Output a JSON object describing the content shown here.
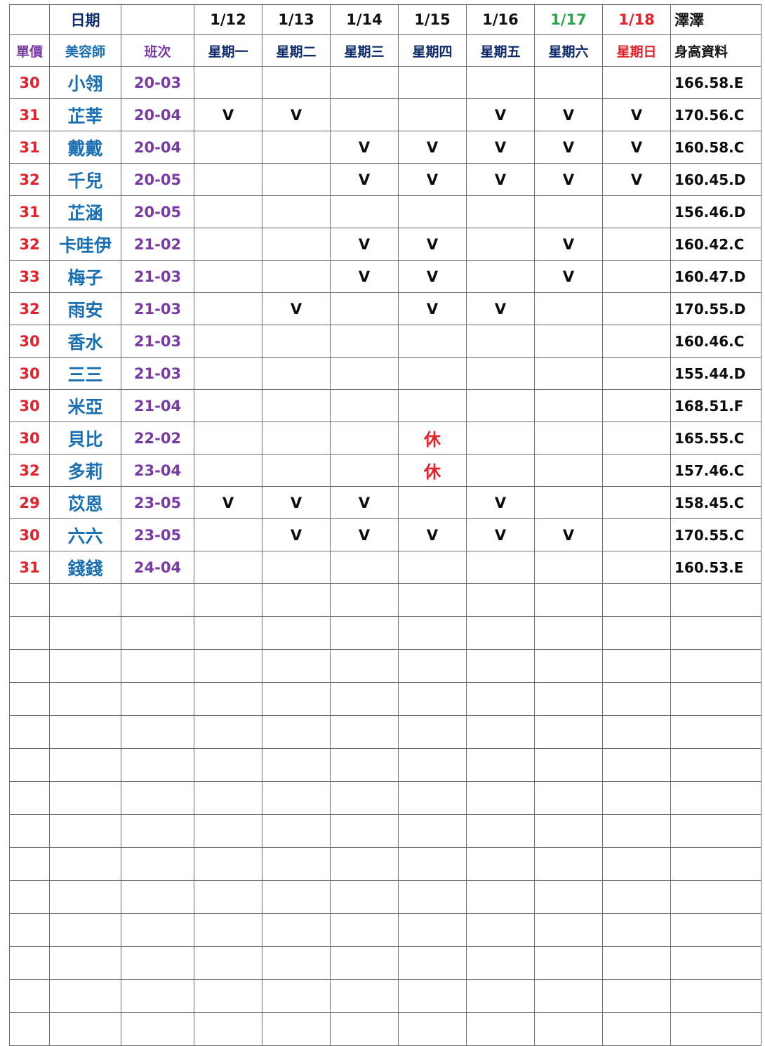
{
  "header": {
    "date_label": "日期",
    "price_label": "單價",
    "beautician_label": "美容師",
    "shift_label": "班次",
    "dates": [
      {
        "date": "1/12",
        "weekday": "星期一",
        "style": "normal"
      },
      {
        "date": "1/13",
        "weekday": "星期二",
        "style": "normal"
      },
      {
        "date": "1/14",
        "weekday": "星期三",
        "style": "normal"
      },
      {
        "date": "1/15",
        "weekday": "星期四",
        "style": "normal"
      },
      {
        "date": "1/16",
        "weekday": "星期五",
        "style": "normal"
      },
      {
        "date": "1/17",
        "weekday": "星期六",
        "style": "sat"
      },
      {
        "date": "1/18",
        "weekday": "星期日",
        "style": "sun"
      }
    ],
    "right_top": "澤澤",
    "right_bottom": "身高資料",
    "colors": {
      "price": "#e3212b",
      "name": "#1a6fb3",
      "shift": "#7a3aa4",
      "saturday": "#2aa64a",
      "sunday": "#e3212b"
    }
  },
  "rows": [
    {
      "price": "30",
      "name": "小翎",
      "shift": "20-03",
      "days": [
        "",
        "",
        "",
        "",
        "",
        "",
        ""
      ],
      "height": "166.58.E"
    },
    {
      "price": "31",
      "name": "芷莘",
      "shift": "20-04",
      "days": [
        "V",
        "V",
        "",
        "",
        "V",
        "V",
        "V"
      ],
      "height": "170.56.C"
    },
    {
      "price": "31",
      "name": "戴戴",
      "shift": "20-04",
      "days": [
        "",
        "",
        "V",
        "V",
        "V",
        "V",
        "V"
      ],
      "height": "160.58.C"
    },
    {
      "price": "32",
      "name": "千兒",
      "shift": "20-05",
      "days": [
        "",
        "",
        "V",
        "V",
        "V",
        "V",
        "V"
      ],
      "height": "160.45.D"
    },
    {
      "price": "31",
      "name": "芷涵",
      "shift": "20-05",
      "days": [
        "",
        "",
        "",
        "",
        "",
        "",
        ""
      ],
      "height": "156.46.D"
    },
    {
      "price": "32",
      "name": "卡哇伊",
      "shift": "21-02",
      "days": [
        "",
        "",
        "V",
        "V",
        "",
        "V",
        ""
      ],
      "height": "160.42.C"
    },
    {
      "price": "33",
      "name": "梅子",
      "shift": "21-03",
      "days": [
        "",
        "",
        "V",
        "V",
        "",
        "V",
        ""
      ],
      "height": "160.47.D"
    },
    {
      "price": "32",
      "name": "雨安",
      "shift": "21-03",
      "days": [
        "",
        "V",
        "",
        "V",
        "V",
        "",
        ""
      ],
      "height": "170.55.D"
    },
    {
      "price": "30",
      "name": "香水",
      "shift": "21-03",
      "days": [
        "",
        "",
        "",
        "",
        "",
        "",
        ""
      ],
      "height": "160.46.C"
    },
    {
      "price": "30",
      "name": "三三",
      "shift": "21-03",
      "days": [
        "",
        "",
        "",
        "",
        "",
        "",
        ""
      ],
      "height": "155.44.D"
    },
    {
      "price": "30",
      "name": "米亞",
      "shift": "21-04",
      "days": [
        "",
        "",
        "",
        "",
        "",
        "",
        ""
      ],
      "height": "168.51.F"
    },
    {
      "price": "30",
      "name": "貝比",
      "shift": "22-02",
      "days": [
        "",
        "",
        "",
        "休",
        "",
        "",
        ""
      ],
      "height": "165.55.C"
    },
    {
      "price": "32",
      "name": "多莉",
      "shift": "23-04",
      "days": [
        "",
        "",
        "",
        "休",
        "",
        "",
        ""
      ],
      "height": "157.46.C"
    },
    {
      "price": "29",
      "name": "苡恩",
      "shift": "23-05",
      "days": [
        "V",
        "V",
        "V",
        "",
        "V",
        "",
        ""
      ],
      "height": "158.45.C"
    },
    {
      "price": "30",
      "name": "六六",
      "shift": "23-05",
      "days": [
        "",
        "V",
        "V",
        "V",
        "V",
        "V",
        ""
      ],
      "height": "170.55.C"
    },
    {
      "price": "31",
      "name": "錢錢",
      "shift": "24-04",
      "days": [
        "",
        "",
        "",
        "",
        "",
        "",
        ""
      ],
      "height": "160.53.E"
    }
  ],
  "empty_rows": 14
}
